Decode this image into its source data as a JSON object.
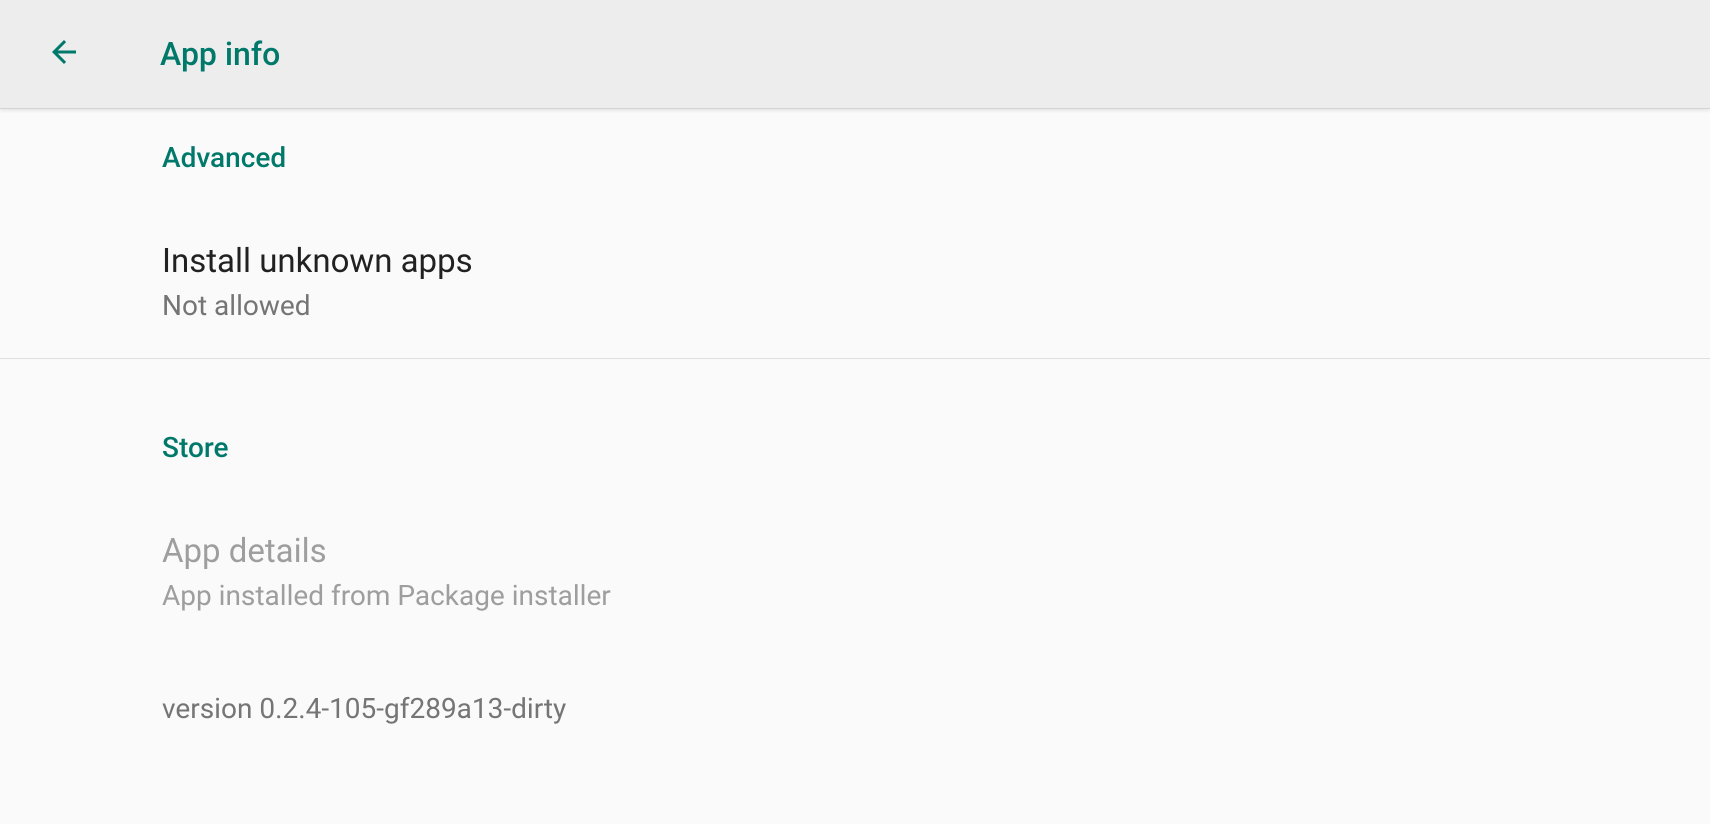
{
  "header": {
    "title": "App info"
  },
  "sections": {
    "advanced": {
      "label": "Advanced",
      "install_unknown": {
        "title": "Install unknown apps",
        "subtitle": "Not allowed"
      }
    },
    "store": {
      "label": "Store",
      "app_details": {
        "title": "App details",
        "subtitle": "App installed from Package installer"
      },
      "version": "version 0.2.4-105-gf289a13-dirty"
    }
  }
}
